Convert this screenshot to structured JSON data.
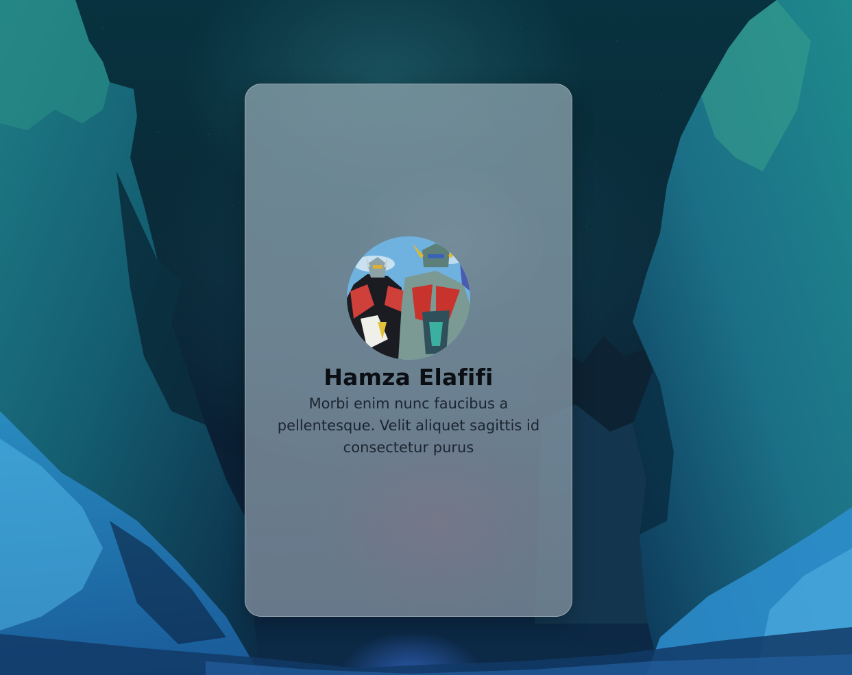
{
  "profile": {
    "name": "Hamza Elafifi",
    "bio": "Morbi enim nunc faucibus a pellentesque. Velit aliquet sagittis id consectetur purus",
    "avatar_icon": "robot-avatar-image"
  },
  "colors": {
    "card_background": "#7f95a3",
    "name_text": "#0b0f14",
    "bio_text": "#1c2430",
    "sky": "#08323f"
  }
}
